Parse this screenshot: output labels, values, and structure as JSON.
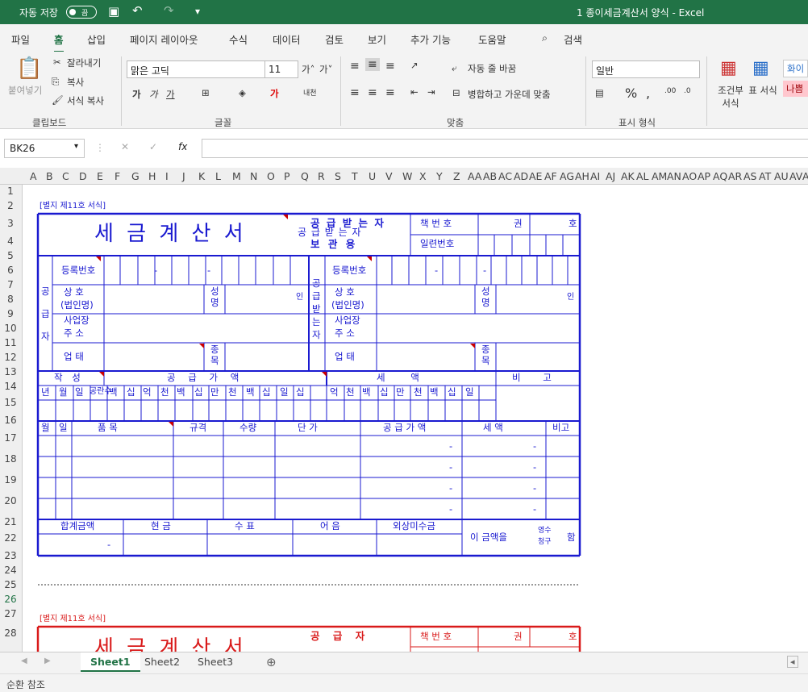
{
  "titlebar": {
    "autosave": "자동 저장",
    "autosave_state": "끔",
    "title": "1 종이세금계산서 양식 - Excel"
  },
  "menu": [
    "파일",
    "홈",
    "삽입",
    "페이지 레이아웃",
    "수식",
    "데이터",
    "검토",
    "보기",
    "추가 기능",
    "도움말",
    "검색"
  ],
  "ribbon": {
    "paste": "붙여넣기",
    "cut": "잘라내기",
    "copy": "복사",
    "format_painter": "서식 복사",
    "clipboard": "클립보드",
    "font_name": "맑은 고딕",
    "font_size": "11",
    "font_group": "글꼴",
    "wrap": "자동 줄 바꿈",
    "merge": "병합하고 가운데 맞춤",
    "align_group": "맞춤",
    "number_format": "일반",
    "number_group": "표시 형식",
    "cond": "조건부 서식",
    "table": "표 서식",
    "style1": "화이",
    "style2": "나쁨"
  },
  "formula_bar": {
    "namebox": "BK26",
    "fx": "fx"
  },
  "columns": [
    "A",
    "B",
    "C",
    "D",
    "E",
    "F",
    "G",
    "H",
    "I",
    "J",
    "K",
    "L",
    "M",
    "N",
    "O",
    "P",
    "Q",
    "R",
    "S",
    "T",
    "U",
    "V",
    "W",
    "X",
    "Y",
    "Z",
    "AA",
    "AB",
    "AC",
    "AD",
    "AE",
    "AF",
    "AG",
    "AH",
    "AI",
    "AJ",
    "AK",
    "AL",
    "AM",
    "AN",
    "AO",
    "AP",
    "AQ",
    "AR",
    "AS",
    "AT",
    "AU",
    "AV",
    "AW"
  ],
  "rows": [
    "1",
    "2",
    "3",
    "4",
    "5",
    "6",
    "7",
    "8",
    "9",
    "10",
    "11",
    "12",
    "13",
    "14",
    "15",
    "16",
    "17",
    "18",
    "19",
    "20",
    "21",
    "22",
    "23",
    "24",
    "25",
    "26",
    "27",
    "28"
  ],
  "invoice": {
    "form_no": "[별지 제11호 서식]",
    "title": "세 금 계 산 서",
    "copy_type_top": "공 급 받 는 자",
    "copy_type_bottom": "보 관 용",
    "book_no": "책 번 호",
    "kwon": "권",
    "ho": "호",
    "serial": "일련번호",
    "supplier": "공급자",
    "receiver": "공급받는자",
    "reg_no": "등록번호",
    "company": "상 호",
    "company_paren": "(법인명)",
    "name": "성명",
    "seal": "인",
    "address1": "사업장",
    "address2": "주 소",
    "biz_type": "업 태",
    "biz_item": "종목",
    "written": "작 성",
    "supply_amount": "공 급 가 액",
    "tax": "세 액",
    "remark": "비 고",
    "date_cols": [
      "년",
      "월",
      "일",
      "공란수",
      "백",
      "십",
      "억",
      "천",
      "백",
      "십",
      "만",
      "천",
      "백",
      "십",
      "일",
      "십",
      "억",
      "천",
      "백",
      "십",
      "만",
      "천",
      "백",
      "십",
      "일"
    ],
    "item_headers": [
      "월",
      "일",
      "품 목",
      "규격",
      "수량",
      "단 가",
      "공 급 가 액",
      "세 액",
      "비고"
    ],
    "item_dash": "-",
    "total_headers": [
      "합계금액",
      "현 금",
      "수 표",
      "어 음",
      "외상미수금"
    ],
    "total_value": "-",
    "amount_text": "이 금액을",
    "receipt": "영수",
    "claim": "청구",
    "ham": "함",
    "copy2_top": "공 급 자"
  },
  "sheets": [
    "Sheet1",
    "Sheet2",
    "Sheet3"
  ],
  "status": "순환 참조"
}
